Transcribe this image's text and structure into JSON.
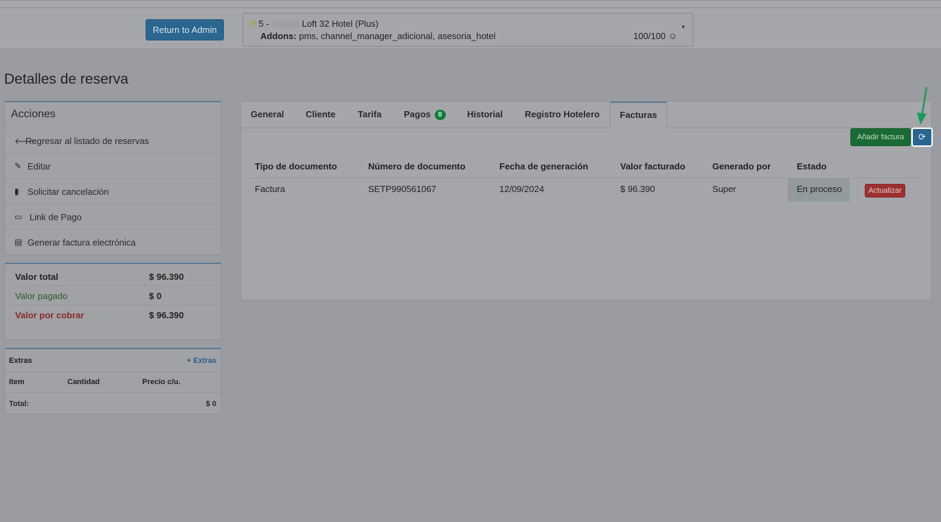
{
  "header": {
    "return_admin": "Return to Admin",
    "hotel_prefix": "5 -",
    "hotel_name": "Loft 32 Hotel (Plus)",
    "addons_label": "Addons:",
    "addons_value": "pms, channel_manager_adicional, asesoria_hotel",
    "score": "100/100 ☺"
  },
  "page_title": "Detalles de reserva",
  "actions": {
    "title": "Acciones",
    "items": [
      {
        "label": "Regresar al listado de reservas",
        "icon": "arrow-left-icon"
      },
      {
        "label": "Editar",
        "icon": "pencil-icon"
      },
      {
        "label": "Solicitar cancelación",
        "icon": "book-icon"
      },
      {
        "label": "Link de Pago",
        "icon": "credit-card-icon"
      },
      {
        "label": "Generar factura electrónica",
        "icon": "file-icon"
      }
    ]
  },
  "totals": [
    {
      "label": "Valor total",
      "value": "$ 96.390",
      "color": "#222222"
    },
    {
      "label": "Valor pagado",
      "value": "$ 0",
      "color": "#2d5a26"
    },
    {
      "label": "Valor por cobrar",
      "value": "$ 96.390",
      "color": "#8a2a2a"
    }
  ],
  "extras": {
    "title": "Extras",
    "add_label": "+ Extras",
    "columns": [
      "Item",
      "Cantidad",
      "Precio c/u."
    ],
    "total_label": "Total:",
    "total_value": "$ 0"
  },
  "tabs": [
    {
      "label": "General"
    },
    {
      "label": "Cliente"
    },
    {
      "label": "Tarifa"
    },
    {
      "label": "Pagos",
      "badge": "0"
    },
    {
      "label": "Historial"
    },
    {
      "label": "Registro Hotelero"
    },
    {
      "label": "Facturas",
      "active": true
    }
  ],
  "toolbar": {
    "add_invoice": "Añadir factura",
    "refresh_icon": "refresh-icon"
  },
  "invoices": {
    "columns": [
      "Tipo de documento",
      "Número de documento",
      "Fecha de generación",
      "Valor facturado",
      "Generado por",
      "Estado"
    ],
    "rows": [
      {
        "tipo": "Factura",
        "numero": "SETP990561067",
        "fecha": "12/09/2024",
        "valor": "$ 96.390",
        "generado": "Super",
        "estado": "En proceso",
        "action": "Actualizar"
      }
    ]
  }
}
